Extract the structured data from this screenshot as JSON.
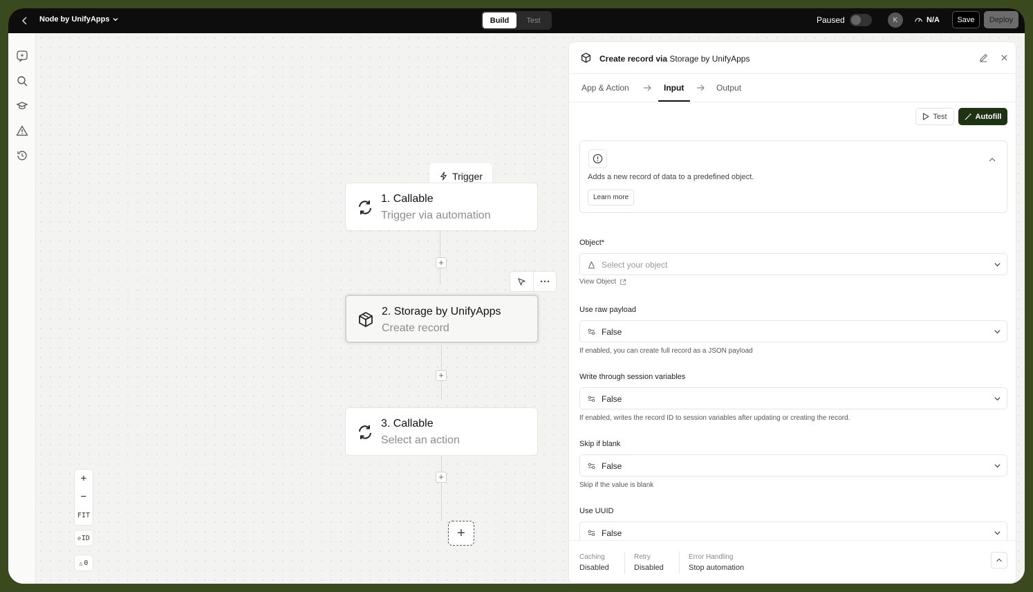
{
  "topbar": {
    "app_title": "Node by UnifyApps",
    "mode_tabs": [
      "Build",
      "Test"
    ],
    "active_mode": "Build",
    "paused_label": "Paused",
    "avatar_initial": "K",
    "speed_label": "N/A",
    "save_label": "Save",
    "deploy_label": "Deploy"
  },
  "canvas": {
    "trigger_label": "Trigger",
    "nodes": [
      {
        "title": "1. Callable",
        "subtitle": "Trigger via automation"
      },
      {
        "title": "2. Storage by UnifyApps",
        "subtitle": "Create record"
      },
      {
        "title": "3. Callable",
        "subtitle": "Select an action"
      }
    ],
    "zoom": {
      "in": "+",
      "out": "−",
      "fit": "FIT",
      "id": "ID",
      "warnings": "0"
    }
  },
  "panel": {
    "title_bold": "Create record via",
    "title_rest": " Storage by UnifyApps",
    "tabs": [
      "App & Action",
      "Input",
      "Output"
    ],
    "active_tab": "Input",
    "test_label": "Test",
    "autofill_label": "Autofill",
    "info_text": "Adds a new record of data to a predefined object.",
    "learn_more": "Learn more",
    "fields": {
      "object": {
        "label": "Object*",
        "placeholder": "Select your object",
        "view_link": "View Object"
      },
      "raw_payload": {
        "label": "Use raw payload",
        "value": "False",
        "help": "If enabled, you can create full record as a JSON payload"
      },
      "session_vars": {
        "label": "Write through session variables",
        "value": "False",
        "help": "If enabled, writes the record ID to session variables after updating or creating the record."
      },
      "skip_blank": {
        "label": "Skip if blank",
        "value": "False",
        "help": "Skip if the value is blank"
      },
      "uuid": {
        "label": "Use UUID",
        "value": "False"
      }
    },
    "footer": [
      {
        "key": "Caching",
        "value": "Disabled"
      },
      {
        "key": "Retry",
        "value": "Disabled"
      },
      {
        "key": "Error Handling",
        "value": "Stop automation"
      }
    ]
  },
  "colors": {
    "accent": "#1e3214",
    "frame": "#3a4a1e"
  }
}
